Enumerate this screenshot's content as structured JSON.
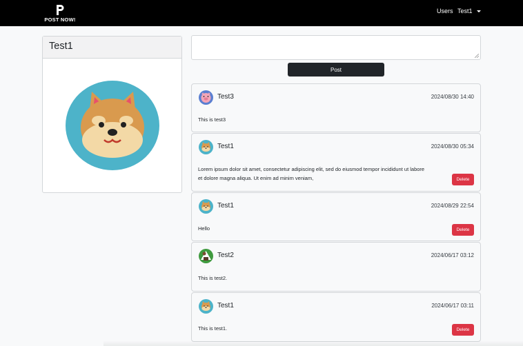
{
  "navbar": {
    "brand_letter": "P",
    "brand_name": "POST NOW!",
    "users_link": "Users",
    "current_user": "Test1"
  },
  "profile": {
    "name": "Test1",
    "avatar": "shiba-dog-icon"
  },
  "composer": {
    "text_value": "",
    "post_label": "Post"
  },
  "posts": [
    {
      "author": "Test3",
      "avatar": "pig-icon",
      "date": "2024/08/30 14:40",
      "text": "This is test3",
      "delete_label": ""
    },
    {
      "author": "Test1",
      "avatar": "shiba-dog-icon",
      "date": "2024/08/30 05:34",
      "text_line1": "Lorem ipsum dolor sit amet, consectetur adipiscing elit, sed do eiusmod tempor incididunt ut labore",
      "text_line2": "et dolore magna aliqua. Ut enim ad minim veniam,",
      "delete_label": "Delete"
    },
    {
      "author": "Test1",
      "avatar": "shiba-dog-icon",
      "date": "2024/08/29 22:54",
      "text": "Hello",
      "delete_label": "Delete"
    },
    {
      "author": "Test2",
      "avatar": "onigiri-icon",
      "date": "2024/06/17 03:12",
      "text": "This is test2.",
      "delete_label": ""
    },
    {
      "author": "Test1",
      "avatar": "shiba-dog-icon",
      "date": "2024/06/17 03:11",
      "text": "This is test1.",
      "delete_label": "Delete"
    }
  ],
  "colors": {
    "navbar": "#000000",
    "post_button": "#212529",
    "delete_button": "#dc3545",
    "avatar_bg": "#4db3c9"
  }
}
